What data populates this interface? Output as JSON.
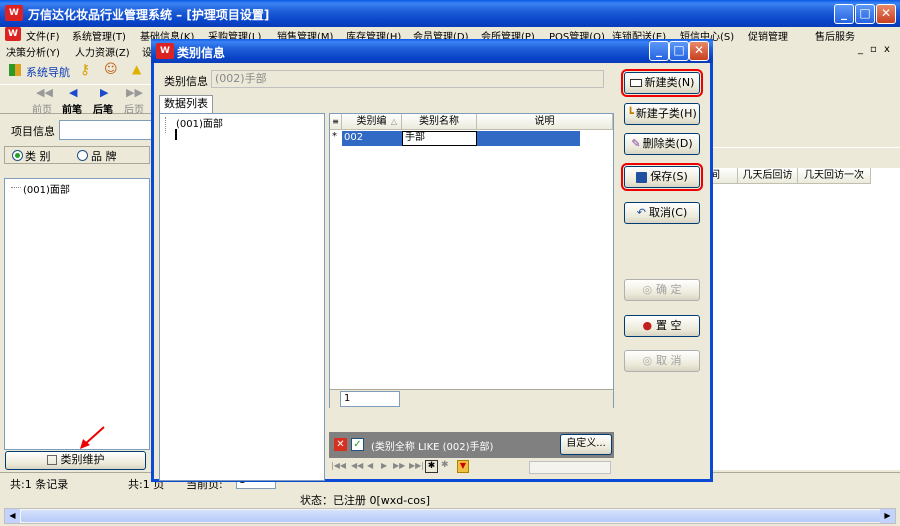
{
  "main_window": {
    "title": "万信达化妆品行业管理系统 – [护理项目设置]",
    "min": "_",
    "max": "□",
    "close": "✕"
  },
  "menus": {
    "row1": [
      "文件(F)",
      "系统管理(T)",
      "基础信息(K)",
      "采购管理(L)",
      "销售管理(M)",
      "库存管理(H)",
      "会员管理(D)",
      "会所管理(P)",
      "POS管理(Q)",
      "连锁配送(E)",
      "短信中心(S)",
      "促销管理",
      "售后服务"
    ],
    "row2": [
      "决策分析(Y)",
      "人力资源(Z)",
      "设"
    ]
  },
  "left_panel": {
    "nav_label": "系统导航",
    "toolbar": [
      "前页",
      "前笔",
      "后笔",
      "后页"
    ],
    "project_info_label": "项目信息",
    "radio_category": "类 别",
    "radio_brand": "品 牌",
    "tree_item": "(001)面部",
    "maintain_button": "类别维护"
  },
  "right_grid": {
    "headers": [
      "间",
      "几天后回访",
      "几天回访一次"
    ]
  },
  "status_bar": {
    "total_records": "共:1 条记录",
    "pages": "共:1 页",
    "current_page_label": "当前页:",
    "current_page": "1",
    "status": "状态：已注册 0[wxd-cos]"
  },
  "dialog": {
    "title": "类别信息",
    "category_info_label": "类别信息",
    "category_info_value": "(002)手部",
    "tab_label": "数据列表",
    "tree_item": "(001)面部",
    "grid_headers": [
      "类别编",
      "类别名称",
      "说明"
    ],
    "row": {
      "marker": "*",
      "code": "002",
      "name": "手部",
      "desc": ""
    },
    "pager_value": "1",
    "filter_text": "(类别全称 LIKE (002)手部)",
    "customize_button": "自定义...",
    "buttons": {
      "new_category": "新建类(N)",
      "new_subcategory": "新建子类(H)",
      "delete_category": "删除类(D)",
      "save": "保存(S)",
      "cancel": "取消(C)",
      "confirm": "确 定",
      "clear": "置 空",
      "cancel2": "取 消"
    }
  },
  "colors": {
    "title_blue": "#0a4ad4",
    "highlight_red": "#e00000",
    "selection_blue": "#316ac5"
  }
}
